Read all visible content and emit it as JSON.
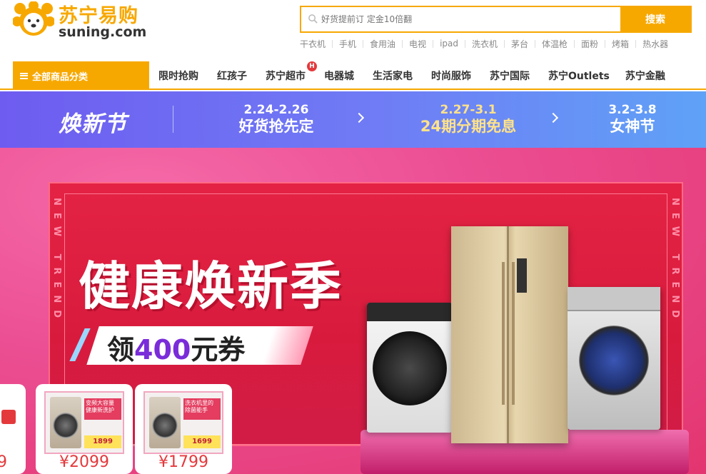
{
  "header": {
    "logo_cn": "苏宁易购",
    "logo_en": "suning.com",
    "search": {
      "placeholder": "好货提前订 定金10倍翻",
      "button_label": "搜索"
    },
    "hot_words": [
      "干衣机",
      "手机",
      "食用油",
      "电视",
      "ipad",
      "洗衣机",
      "茅台",
      "体温枪",
      "面粉",
      "烤箱",
      "热水器"
    ]
  },
  "nav": {
    "category_label": "全部商品分类",
    "items": [
      "限时抢购",
      "红孩子",
      "苏宁超市",
      "电器城",
      "生活家电",
      "时尚服饰",
      "苏宁国际",
      "苏宁Outlets",
      "苏宁金融"
    ],
    "hot_badge": "H"
  },
  "promo": {
    "brand": "焕新节",
    "steps": [
      {
        "date": "2.24-2.26",
        "label": "好货抢先定"
      },
      {
        "date": "2.27-3.1",
        "label": "24期分期免息"
      },
      {
        "date": "3.2-3.8",
        "label": "女神节"
      }
    ]
  },
  "hero": {
    "title": "健康焕新季",
    "coupon_prefix": "领",
    "coupon_amount": "400",
    "coupon_suffix": "元券",
    "side_text_left": "NEW TREND",
    "side_text_right": "NEW TREND"
  },
  "products": [
    {
      "price": "¥2099",
      "tag": "变频大容量 健康新洗护",
      "mini_price": "1899"
    },
    {
      "price": "¥1799",
      "tag": "洗衣机里的 除菌能手",
      "mini_price": "1699"
    }
  ],
  "partial_product": {
    "price": "9"
  },
  "colors": {
    "accent": "#f7a800",
    "promo_active": "#ffe28a",
    "price": "#e4393c"
  }
}
